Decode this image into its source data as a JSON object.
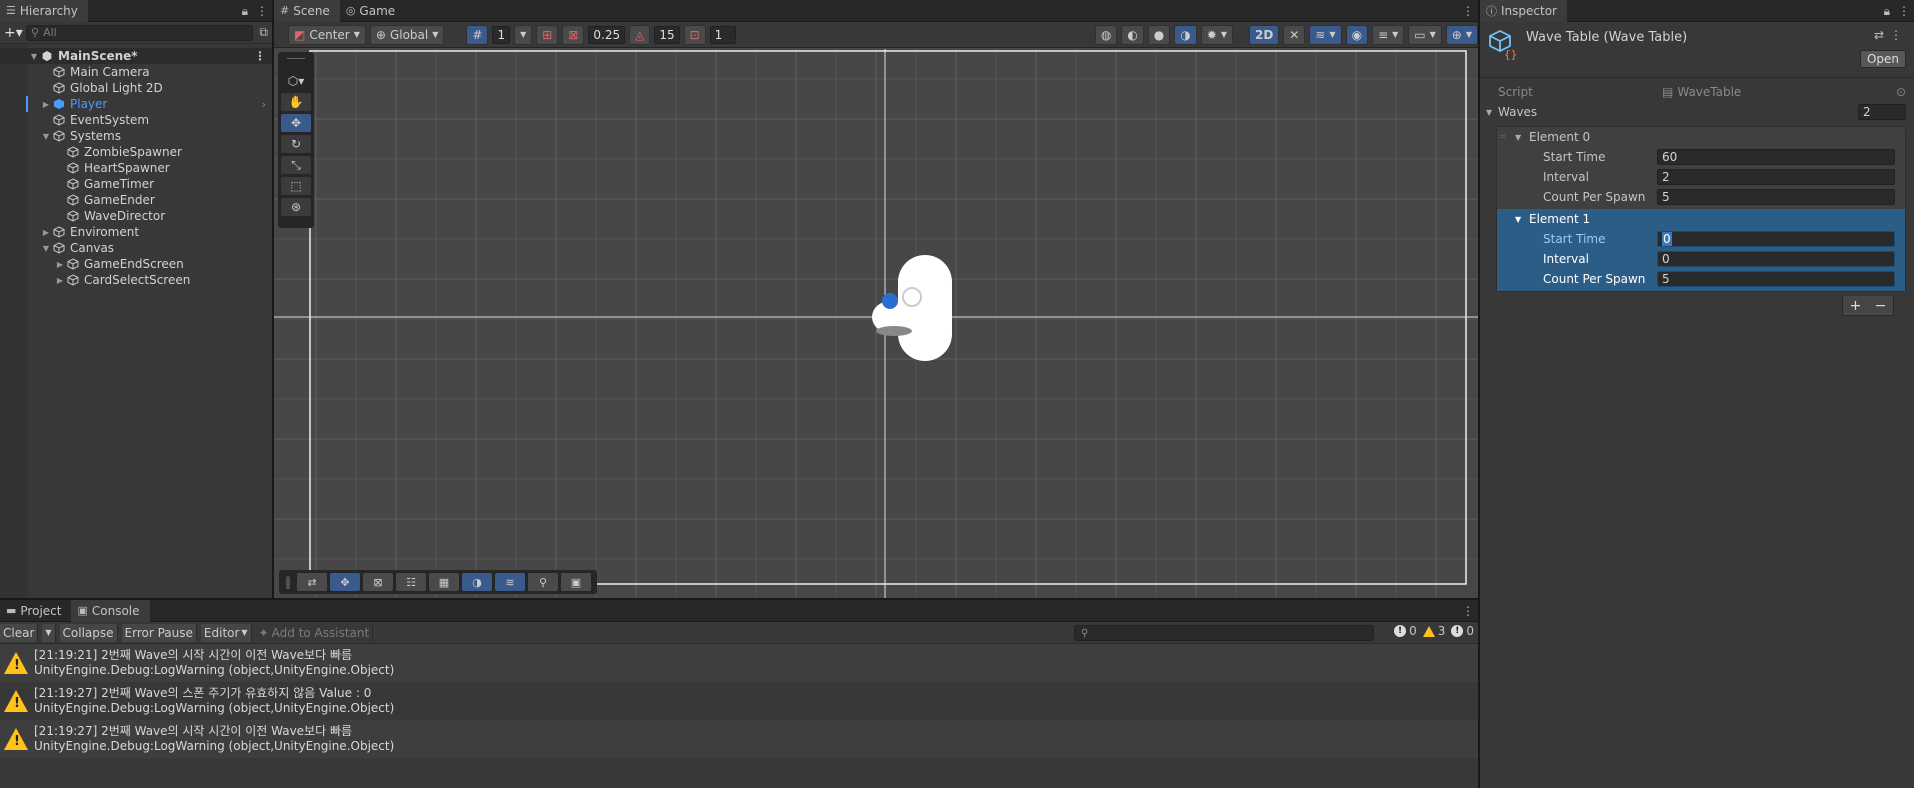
{
  "hierarchy": {
    "tab_label": "Hierarchy",
    "search_placeholder": "All",
    "items": [
      {
        "label": "MainScene*"
      },
      {
        "label": "Main Camera"
      },
      {
        "label": "Global Light 2D"
      },
      {
        "label": "Player"
      },
      {
        "label": "EventSystem"
      },
      {
        "label": "Systems"
      },
      {
        "label": "ZombieSpawner"
      },
      {
        "label": "HeartSpawner"
      },
      {
        "label": "GameTimer"
      },
      {
        "label": "GameEnder"
      },
      {
        "label": "WaveDirector"
      },
      {
        "label": "Enviroment"
      },
      {
        "label": "Canvas"
      },
      {
        "label": "GameEndScreen"
      },
      {
        "label": "CardSelectScreen"
      }
    ]
  },
  "scene": {
    "tabs": [
      {
        "label": "Scene"
      },
      {
        "label": "Game"
      }
    ],
    "pivot": "Center",
    "space": "Global",
    "grid_value": "1",
    "snap_value": "0.25",
    "rotate_value": "15",
    "scale_value": "1",
    "mode_2d": "2D"
  },
  "inspector": {
    "tab_label": "Inspector",
    "title": "Wave Table (Wave Table)",
    "open_label": "Open",
    "script_label": "Script",
    "script_value": "WaveTable",
    "waves_label": "Waves",
    "waves_count": "2",
    "elements": [
      {
        "name": "Element 0",
        "fields": [
          {
            "label": "Start Time",
            "value": "60"
          },
          {
            "label": "Interval",
            "value": "2"
          },
          {
            "label": "Count Per Spawn",
            "value": "5"
          }
        ]
      },
      {
        "name": "Element 1",
        "fields": [
          {
            "label": "Start Time",
            "value": "0"
          },
          {
            "label": "Interval",
            "value": "0"
          },
          {
            "label": "Count Per Spawn",
            "value": "5"
          }
        ]
      }
    ],
    "add_label": "+",
    "remove_label": "−"
  },
  "console": {
    "tabs": [
      {
        "label": "Project"
      },
      {
        "label": "Console"
      }
    ],
    "clear_label": "Clear",
    "collapse_label": "Collapse",
    "error_pause_label": "Error Pause",
    "editor_label": "Editor",
    "assistant_label": "Add to Assistant",
    "count_info": "0",
    "count_warn": "3",
    "count_error": "0",
    "logs": [
      {
        "line1": "[21:19:21] 2번째 Wave의 시작 시간이 이전 Wave보다 빠름",
        "line2": "UnityEngine.Debug:LogWarning (object,UnityEngine.Object)"
      },
      {
        "line1": "[21:19:27] 2번째 Wave의 스폰 주기가 유효하지 않음 Value : 0",
        "line2": "UnityEngine.Debug:LogWarning (object,UnityEngine.Object)"
      },
      {
        "line1": "[21:19:27] 2번째 Wave의 시작 시간이 이전 Wave보다 빠름",
        "line2": "UnityEngine.Debug:LogWarning (object,UnityEngine.Object)"
      }
    ]
  },
  "colors": {
    "accent": "#3a5a8c",
    "selection": "#2c5d87",
    "warning": "#ffc21a",
    "player_text": "#4c9bff"
  }
}
